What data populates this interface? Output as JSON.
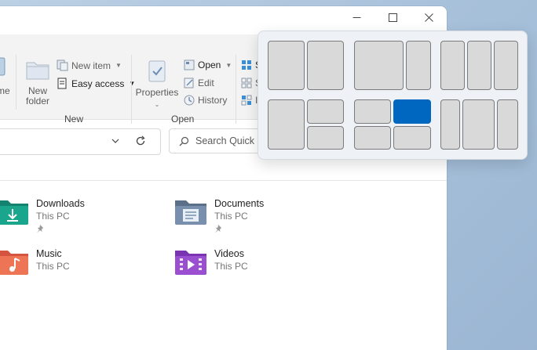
{
  "window": {
    "controls": {
      "minimize": "minimize",
      "maximize": "maximize",
      "close": "close"
    }
  },
  "ribbon": {
    "cut_label_fragment": "me",
    "new_group": {
      "new_folder_label_line1": "New",
      "new_folder_label_line2": "folder",
      "new_item_label": "New item",
      "easy_access_label": "Easy access",
      "group_label": "New"
    },
    "open_group": {
      "properties_label": "Properties",
      "open_label": "Open",
      "edit_label": "Edit",
      "history_label": "History",
      "group_label": "Open"
    },
    "select_group": {
      "item1_fragment": "S",
      "item2_fragment": "S",
      "item3_fragment": "I"
    }
  },
  "address": {
    "search_placeholder": "Search Quick"
  },
  "folders": [
    {
      "name": "Downloads",
      "location": "This PC",
      "pinned": true,
      "icon": "downloads-folder-icon",
      "color": "#1a9a8a"
    },
    {
      "name": "Documents",
      "location": "This PC",
      "pinned": true,
      "icon": "documents-folder-icon",
      "color": "#6d84a3"
    },
    {
      "name": "Music",
      "location": "This PC",
      "pinned": false,
      "icon": "music-folder-icon",
      "color": "#e8694f"
    },
    {
      "name": "Videos",
      "location": "This PC",
      "pinned": false,
      "icon": "videos-folder-icon",
      "color": "#8e44c4"
    }
  ],
  "snap_layouts": {
    "accent_color": "#0067c0",
    "layouts": [
      {
        "name": "two-equal-columns",
        "selected": false
      },
      {
        "name": "wide-left-narrow-right",
        "selected": false
      },
      {
        "name": "three-equal-columns",
        "selected": false
      },
      {
        "name": "left-half-right-two-rows",
        "selected": false
      },
      {
        "name": "four-quadrants",
        "selected": true,
        "selected_zone": "top-right"
      },
      {
        "name": "narrow-wide-narrow",
        "selected": false
      }
    ]
  }
}
